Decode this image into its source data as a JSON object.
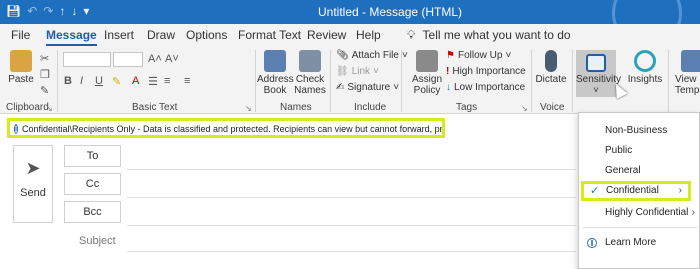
{
  "titlebar": {
    "title": "Untitled  -  Message (HTML)",
    "qat": [
      "save-icon",
      "undo-icon",
      "redo-icon",
      "up-icon",
      "down-icon",
      "customize-icon"
    ]
  },
  "tabs": [
    "File",
    "Message",
    "Insert",
    "Draw",
    "Options",
    "Format Text",
    "Review",
    "Help"
  ],
  "tell_me": "Tell me what you want to do",
  "ribbon": {
    "clipboard": {
      "paste": "Paste",
      "group": "Clipboard"
    },
    "basic_text": {
      "group": "Basic Text",
      "bold": "B",
      "italic": "I",
      "underline": "U"
    },
    "names": {
      "address_book": "Address Book",
      "check_names": "Check Names",
      "group": "Names"
    },
    "include": {
      "attach_file": "Attach File",
      "link": "Link",
      "signature": "Signature",
      "group": "Include"
    },
    "tags": {
      "assign_policy": "Assign Policy",
      "follow_up": "Follow Up",
      "high": "High Importance",
      "low": "Low Importance",
      "group": "Tags"
    },
    "voice": {
      "dictate": "Dictate",
      "group": "Voice"
    },
    "sensitivity": "Sensitivity",
    "insights": "Insights",
    "view_templates": "View Templa"
  },
  "infobar": "Confidential\\Recipients Only - Data is classified and protected. Recipients can view but cannot forward, print or copy the content",
  "compose": {
    "send": "Send",
    "to": "To",
    "cc": "Cc",
    "bcc": "Bcc",
    "subject": "Subject"
  },
  "sensitivity_menu": {
    "items": [
      "Non-Business",
      "Public",
      "General",
      "Confidential",
      "Highly Confidential"
    ],
    "selected": "Confidential",
    "learn_more": "Learn More"
  },
  "colors": {
    "title_bar": "#1f6fbf",
    "accent": "#1f5fa8",
    "highlight": "#d6ea1c",
    "ribbon_bg": "#f3f3f3"
  }
}
